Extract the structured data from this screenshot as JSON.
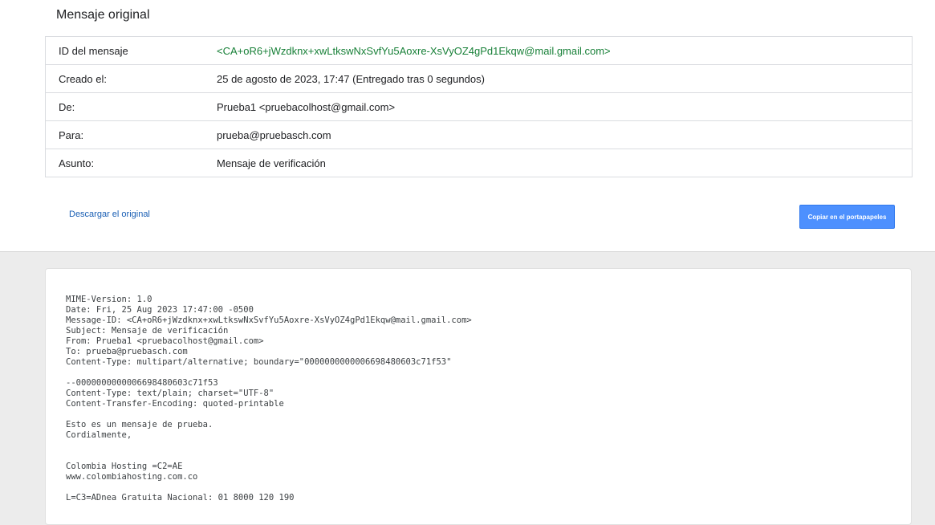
{
  "header": {
    "title": "Mensaje original"
  },
  "meta": {
    "rows": [
      {
        "label": "ID del mensaje",
        "value": "<CA+oR6+jWzdknx+xwLtkswNxSvfYu5Aoxre-XsVyOZ4gPd1Ekqw@mail.gmail.com>"
      },
      {
        "label": "Creado el:",
        "value": "25 de agosto de 2023, 17:47 (Entregado tras 0 segundos)"
      },
      {
        "label": "De:",
        "value": "Prueba1 <pruebacolhost@gmail.com>"
      },
      {
        "label": "Para:",
        "value": "prueba@pruebasch.com"
      },
      {
        "label": "Asunto:",
        "value": "Mensaje de verificación"
      }
    ]
  },
  "actions": {
    "download_label": "Descargar el original",
    "copy_label": "Copiar en el portapapeles"
  },
  "raw": {
    "lines": [
      "MIME-Version: 1.0",
      "Date: Fri, 25 Aug 2023 17:47:00 -0500",
      "Message-ID: <CA+oR6+jWzdknx+xwLtkswNxSvfYu5Aoxre-XsVyOZ4gPd1Ekqw@mail.gmail.com>",
      "Subject: Mensaje de verificación",
      "From: Prueba1 <pruebacolhost@gmail.com>",
      "To: prueba@pruebasch.com",
      "Content-Type: multipart/alternative; boundary=\"0000000000006698480603c71f53\"",
      "",
      "--0000000000006698480603c71f53",
      "Content-Type: text/plain; charset=\"UTF-8\"",
      "Content-Transfer-Encoding: quoted-printable",
      "",
      "Esto es un mensaje de prueba.",
      "Cordialmente,",
      "",
      "",
      "Colombia Hosting =C2=AE",
      "www.colombiahosting.com.co",
      "",
      "L=C3=ADnea Gratuita Nacional: 01 8000 120 190"
    ]
  }
}
